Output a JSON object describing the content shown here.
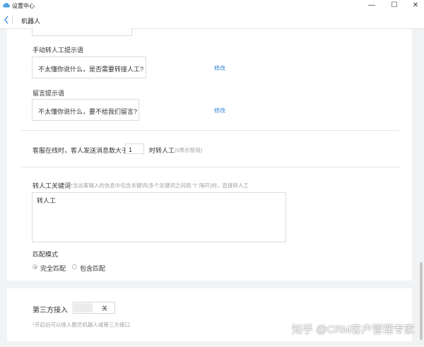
{
  "window": {
    "title": "设置中心",
    "controls": {
      "minimize": "—",
      "maximize": "☐",
      "close": "✕"
    }
  },
  "nav": {
    "title": "机器人"
  },
  "manual_transfer": {
    "label": "手动转人工提示语",
    "text": "不太懂你说什么，是否需要转接人工?",
    "edit": "修改"
  },
  "leave_message": {
    "label": "留言提示语",
    "text": "不太懂你说什么，要不给我们留言?",
    "edit": "修改"
  },
  "auto_transfer": {
    "prefix": "客服在线时，客人发送消息数大于",
    "count": "1",
    "suffix": "时转人工",
    "hint": "(0表示禁用)"
  },
  "keywords": {
    "label": "转人工关键词",
    "hint": "*当访客输入的信息中包含关键词(多个关键词之间用 \"|\" 隔开)时，直接转人工",
    "value": "转人工"
  },
  "match_mode": {
    "label": "匹配模式",
    "options": [
      {
        "label": "完全匹配",
        "selected": true
      },
      {
        "label": "包含匹配",
        "selected": false
      }
    ]
  },
  "third_party": {
    "label": "第三方接入",
    "toggle_label": "关",
    "hint": "*开启后可以接入图灵机器人或第三方接口"
  },
  "watermark": "知乎 @CRM客户管理专家"
}
